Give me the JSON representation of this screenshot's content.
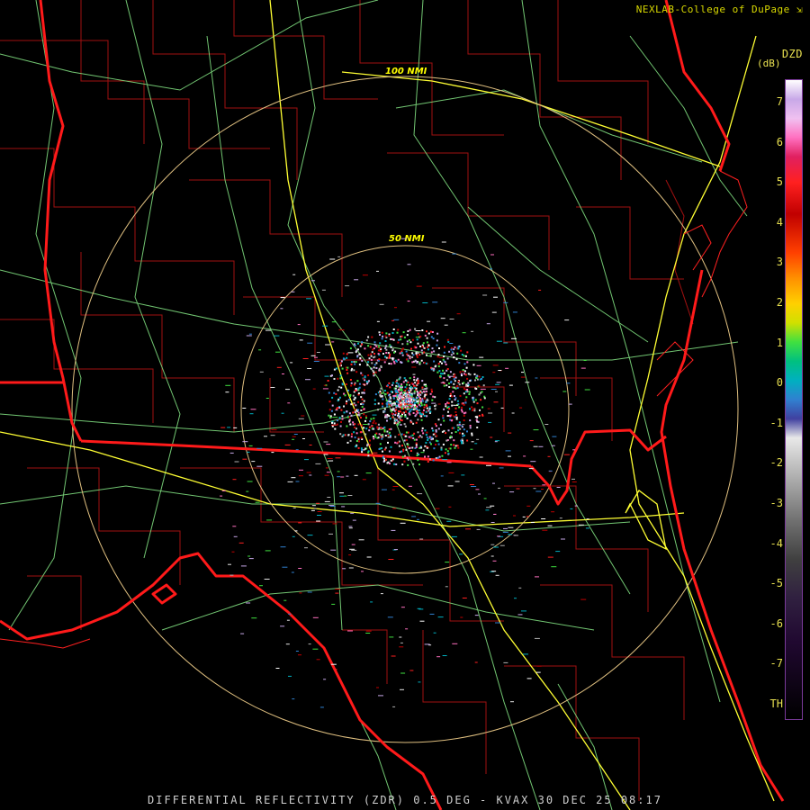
{
  "header": {
    "credit": "NEXLAB-College of DuPage",
    "credit_icon": "logo-arrow-icon",
    "product_code": "DZD",
    "unit": "(dB)"
  },
  "range_rings": [
    {
      "label": "100 NMI"
    },
    {
      "label": "50 NMI"
    }
  ],
  "legend": {
    "ticks": [
      "7",
      "6",
      "5",
      "4",
      "3",
      "2",
      "1",
      "0",
      "-1",
      "-2",
      "-3",
      "-4",
      "-5",
      "-6",
      "-7",
      "TH"
    ]
  },
  "footer": {
    "title": "DIFFERENTIAL REFLECTIVITY (ZDR) 0.5 DEG - KVAX 30 DEC 25 08:17"
  },
  "colors": {
    "state_border": "#ff1a1a",
    "county_border": "#a01010",
    "highway_interstate": "#ffff33",
    "highway_other": "#7fdc7f",
    "range_ring": "#e0c080",
    "label_text": "#e8e050"
  }
}
